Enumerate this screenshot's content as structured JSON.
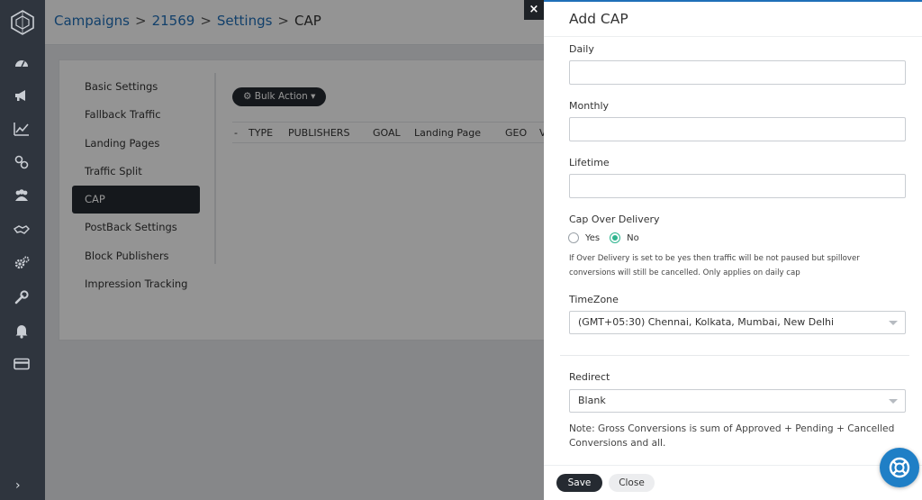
{
  "breadcrumb": {
    "campaigns": "Campaigns",
    "id": "21569",
    "settings": "Settings",
    "current": "CAP",
    "sep": ">"
  },
  "settings_menu": [
    {
      "label": "Basic Settings"
    },
    {
      "label": "Fallback Traffic"
    },
    {
      "label": "Landing Pages"
    },
    {
      "label": "Traffic Split"
    },
    {
      "label": "CAP",
      "active": true
    },
    {
      "label": "PostBack Settings"
    },
    {
      "label": "Block Publishers"
    },
    {
      "label": "Impression Tracking"
    }
  ],
  "table": {
    "bulk_action": "⚙ Bulk Action ▾",
    "columns": [
      "-",
      "TYPE",
      "PUBLISHERS",
      "GOAL",
      "Landing Page",
      "GEO",
      "V"
    ]
  },
  "drawer": {
    "title": "Add CAP",
    "close_icon": "×",
    "daily_label": "Daily",
    "daily_value": "",
    "monthly_label": "Monthly",
    "monthly_value": "",
    "lifetime_label": "Lifetime",
    "lifetime_value": "",
    "over_delivery_label": "Cap Over Delivery",
    "yes_label": "Yes",
    "no_label": "No",
    "over_delivery_selected": "No",
    "over_delivery_help": "If Over Delivery is set to be yes then traffic will be not paused but spillover conversions will still be cancelled. Only applies on daily cap",
    "timezone_label": "TimeZone",
    "timezone_value": "(GMT+05:30) Chennai, Kolkata, Mumbai, New Delhi",
    "redirect_label": "Redirect",
    "redirect_value": "Blank",
    "note": "Note: Gross Conversions is sum of Approved + Pending + Cancelled Conversions and all.",
    "save_label": "Save",
    "close_label": "Close"
  },
  "colors": {
    "accent": "#1f6fb8",
    "dark": "#252a31",
    "radio_on": "#2fb58f",
    "rail": "#2f353e"
  },
  "icons": [
    "logo-icon",
    "dashboard-icon",
    "megaphone-icon",
    "chart-icon",
    "link-icon",
    "users-icon",
    "handshake-icon",
    "gears-icon",
    "wrench-icon",
    "bell-icon",
    "card-icon",
    "chevron-right-icon",
    "lifebuoy-icon"
  ]
}
